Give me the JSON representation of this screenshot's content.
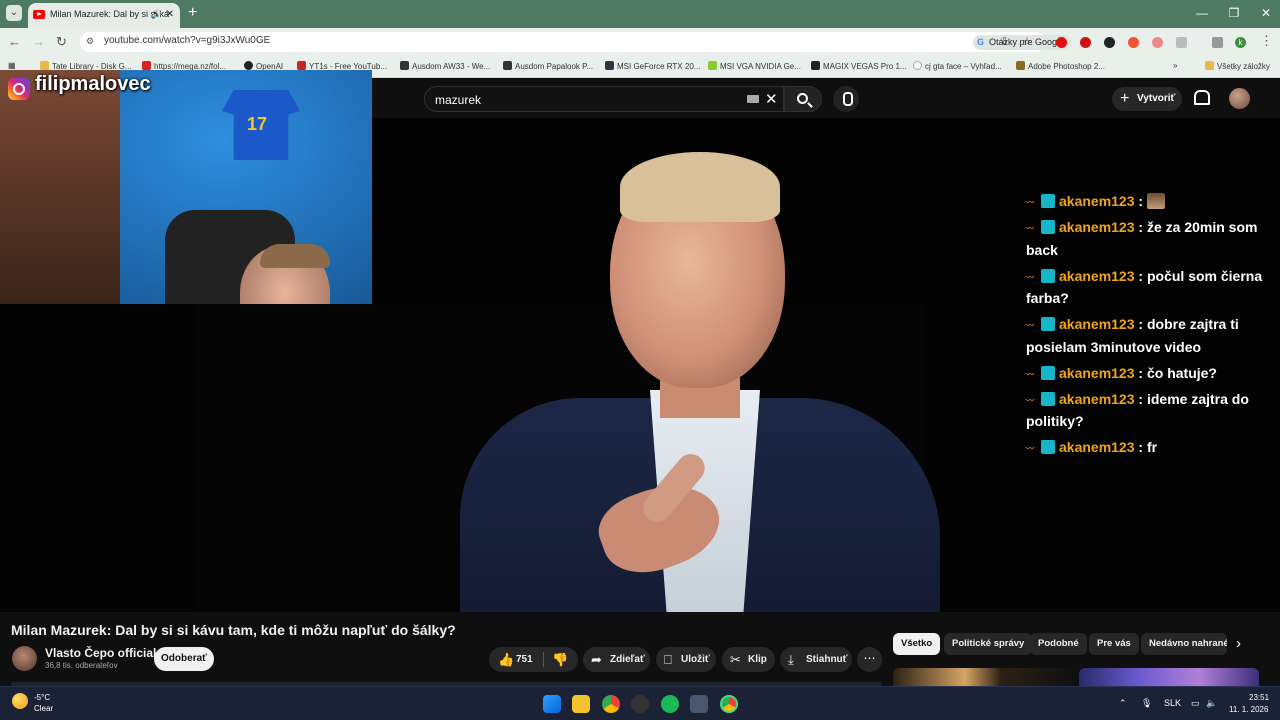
{
  "browser": {
    "tab_title": "Milan Mazurek: Dal by si si ká",
    "url": "youtube.com/watch?v=g9i3JxWu0GE",
    "google_chip": "Otázky pre Google",
    "bookmarks": [
      "Tate Library - Disk G...",
      "https://mega.nz/fol...",
      "OpenAI",
      "YT1s - Free YouTub...",
      "Ausdom AW33 - We...",
      "Ausdom Papalook P...",
      "MSI GeForce RTX 20...",
      "MSI VGA NVIDIA Ge...",
      "MAGIX VEGAS Pro 1...",
      "cj gta face – Vyhľad...",
      "Adobe Photoshop 2...",
      "Všetky záložky"
    ],
    "profile_initial": "k"
  },
  "youtube": {
    "search_value": "mazurek",
    "create_label": "Vytvoriť",
    "video_title": "Milan Mazurek: Dal by si si kávu tam, kde ti môžu napľuť do šálky?",
    "channel_name": "Vlasto Čepo official",
    "subscribers": "36,8 tis. odberateľov",
    "subscribe_label": "Odoberať",
    "likes": "751",
    "share_label": "Zdieľať",
    "save_label": "Uložiť",
    "clip_label": "Klip",
    "download_label": "Stiahnuť",
    "chips": [
      "Všetko",
      "Politické správy",
      "Podobné",
      "Pre vás",
      "Nedávno nahrané"
    ]
  },
  "overlay": {
    "instagram_handle": "filipmalovec",
    "jersey_number": "17",
    "chat": [
      {
        "user": "akanem123",
        "text": "",
        "emote": true
      },
      {
        "user": "akanem123",
        "text": "že za 20min som back"
      },
      {
        "user": "akanem123",
        "text": "počul som čierna farba?"
      },
      {
        "user": "akanem123",
        "text": "dobre zajtra ti posielam 3minutove video"
      },
      {
        "user": "akanem123",
        "text": "čo hatuje?"
      },
      {
        "user": "akanem123",
        "text": "ideme zajtra do politiky?"
      },
      {
        "user": "akanem123",
        "text": "fr"
      }
    ]
  },
  "taskbar": {
    "temperature": "-5°C",
    "condition": "Clear",
    "language": "SLK",
    "time": "23:51",
    "date": "11. 1. 2026"
  },
  "colors": {
    "youtube_bg": "#0f0f0f",
    "chat_username": "#f0a41e",
    "browser_tabbar": "#4f7a63"
  }
}
